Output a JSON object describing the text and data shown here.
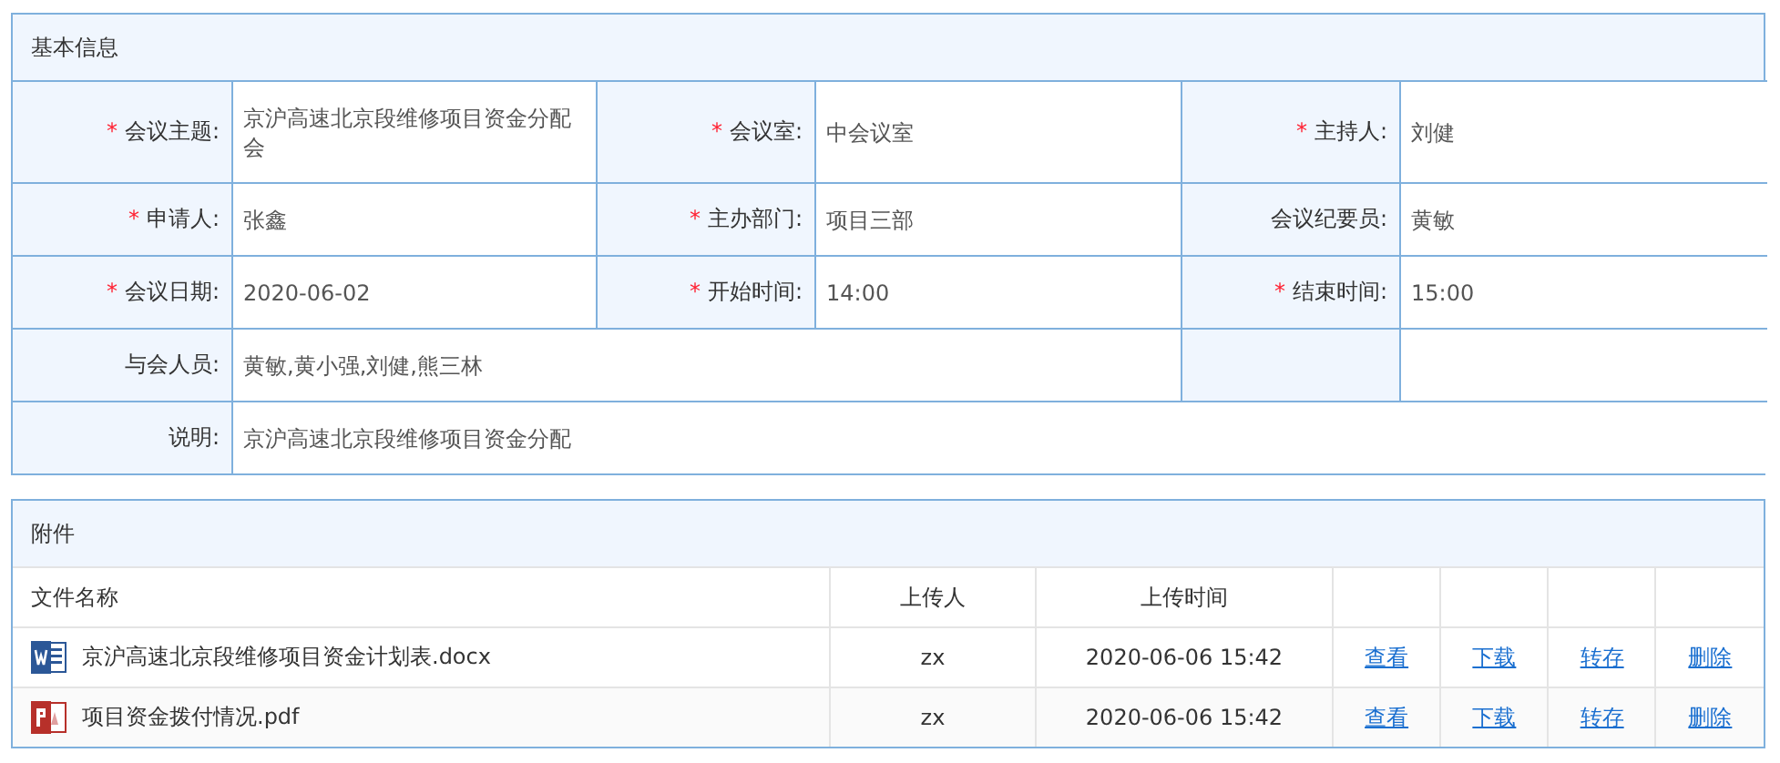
{
  "basic_info": {
    "title": "基本信息",
    "rows": [
      {
        "kind": "triple",
        "fields": [
          {
            "mark": "*",
            "label": "会议主题:",
            "value": "京沪高速北京段维修项目资金分配会"
          },
          {
            "mark": "*",
            "label": "会议室:",
            "value": "中会议室"
          },
          {
            "mark": "*",
            "label": "主持人:",
            "value": "刘健"
          }
        ]
      },
      {
        "kind": "triple",
        "fields": [
          {
            "mark": "*",
            "label": "申请人:",
            "value": "张鑫"
          },
          {
            "mark": "*",
            "label": "主办部门:",
            "value": "项目三部"
          },
          {
            "label": "会议纪要员:",
            "value": "黄敏"
          }
        ]
      },
      {
        "kind": "triple",
        "fields": [
          {
            "mark": "*",
            "label": "会议日期:",
            "value": "2020-06-02"
          },
          {
            "mark": "*",
            "label": "开始时间:",
            "value": "14:00"
          },
          {
            "mark": "*",
            "label": "结束时间:",
            "value": "15:00"
          }
        ]
      },
      {
        "kind": "wide",
        "fields": [
          {
            "label": "与会人员:",
            "value": "黄敏,黄小强,刘健,熊三林"
          }
        ]
      },
      {
        "kind": "full",
        "fields": [
          {
            "label": "说明:",
            "value": "京沪高速北京段维修项目资金分配"
          }
        ]
      }
    ]
  },
  "attachments": {
    "title": "附件",
    "columns": [
      "文件名称",
      "上传人",
      "上传时间"
    ],
    "rows": [
      {
        "kind": "word",
        "name": "京沪高速北京段维修项目资金计划表.docx",
        "uploader": "zx",
        "time": "2020-06-06 15:42",
        "actions": [
          "查看",
          "下载",
          "转存",
          "删除"
        ]
      },
      {
        "kind": "pdf",
        "name": "项目资金拨付情况.pdf",
        "uploader": "zx",
        "time": "2020-06-06 15:42",
        "actions": [
          "查看",
          "下载",
          "转存",
          "删除"
        ]
      }
    ]
  }
}
